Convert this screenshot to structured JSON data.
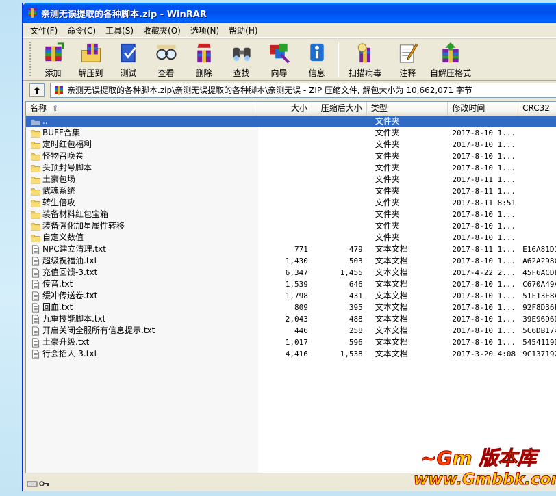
{
  "window": {
    "title": "亲测无误提取的各种脚本.zip - WinRAR"
  },
  "menu": [
    {
      "label": "文件(F)"
    },
    {
      "label": "命令(C)"
    },
    {
      "label": "工具(S)"
    },
    {
      "label": "收藏夹(O)"
    },
    {
      "label": "选项(N)"
    },
    {
      "label": "帮助(H)"
    }
  ],
  "toolbar": [
    {
      "label": "添加",
      "icon": "add-archive-icon"
    },
    {
      "label": "解压到",
      "icon": "extract-to-icon"
    },
    {
      "label": "测试",
      "icon": "test-icon"
    },
    {
      "label": "查看",
      "icon": "view-icon"
    },
    {
      "label": "删除",
      "icon": "delete-icon"
    },
    {
      "label": "查找",
      "icon": "find-icon"
    },
    {
      "label": "向导",
      "icon": "wizard-icon"
    },
    {
      "label": "信息",
      "icon": "info-icon"
    },
    {
      "label": "扫描病毒",
      "icon": "virus-scan-icon"
    },
    {
      "label": "注释",
      "icon": "comment-icon"
    },
    {
      "label": "自解压格式",
      "icon": "sfx-icon"
    }
  ],
  "address": {
    "path": "亲测无误提取的各种脚本.zip\\亲测无误提取的各种脚本\\亲测无误 - ZIP 压缩文件, 解包大小为 10,662,071 字节"
  },
  "columns": {
    "name": "名称",
    "size": "大小",
    "packed": "压缩后大小",
    "type": "类型",
    "modified": "修改时间",
    "crc": "CRC32"
  },
  "rows": [
    {
      "name": "..",
      "size": "",
      "packed": "",
      "type": "文件夹",
      "modified": "",
      "crc": "",
      "kind": "folder",
      "selected": true
    },
    {
      "name": "BUFF合集",
      "size": "",
      "packed": "",
      "type": "文件夹",
      "modified": "2017-8-10 1...",
      "crc": "",
      "kind": "folder"
    },
    {
      "name": "定时红包福利",
      "size": "",
      "packed": "",
      "type": "文件夹",
      "modified": "2017-8-10 1...",
      "crc": "",
      "kind": "folder"
    },
    {
      "name": "怪物召唤卷",
      "size": "",
      "packed": "",
      "type": "文件夹",
      "modified": "2017-8-10 1...",
      "crc": "",
      "kind": "folder"
    },
    {
      "name": "头顶封号脚本",
      "size": "",
      "packed": "",
      "type": "文件夹",
      "modified": "2017-8-10 1...",
      "crc": "",
      "kind": "folder"
    },
    {
      "name": "土豪包场",
      "size": "",
      "packed": "",
      "type": "文件夹",
      "modified": "2017-8-11 1...",
      "crc": "",
      "kind": "folder"
    },
    {
      "name": "武魂系统",
      "size": "",
      "packed": "",
      "type": "文件夹",
      "modified": "2017-8-11 1...",
      "crc": "",
      "kind": "folder"
    },
    {
      "name": "转生倍攻",
      "size": "",
      "packed": "",
      "type": "文件夹",
      "modified": "2017-8-11 8:51",
      "crc": "",
      "kind": "folder"
    },
    {
      "name": "装备材料红包宝箱",
      "size": "",
      "packed": "",
      "type": "文件夹",
      "modified": "2017-8-10 1...",
      "crc": "",
      "kind": "folder"
    },
    {
      "name": "装备强化加星属性转移",
      "size": "",
      "packed": "",
      "type": "文件夹",
      "modified": "2017-8-10 1...",
      "crc": "",
      "kind": "folder"
    },
    {
      "name": "自定义数值",
      "size": "",
      "packed": "",
      "type": "文件夹",
      "modified": "2017-8-10 1...",
      "crc": "",
      "kind": "folder"
    },
    {
      "name": "NPC建立清理.txt",
      "size": "771",
      "packed": "479",
      "type": "文本文档",
      "modified": "2017-8-11 1...",
      "crc": "E16A81D1",
      "kind": "file"
    },
    {
      "name": "超级祝福油.txt",
      "size": "1,430",
      "packed": "503",
      "type": "文本文档",
      "modified": "2017-8-10 1...",
      "crc": "A62A298C",
      "kind": "file"
    },
    {
      "name": "充值回馈-3.txt",
      "size": "6,347",
      "packed": "1,455",
      "type": "文本文档",
      "modified": "2017-4-22 2...",
      "crc": "45F6ACDE",
      "kind": "file"
    },
    {
      "name": "传音.txt",
      "size": "1,539",
      "packed": "646",
      "type": "文本文档",
      "modified": "2017-8-10 1...",
      "crc": "C670A49A",
      "kind": "file"
    },
    {
      "name": "缓冲传送卷.txt",
      "size": "1,798",
      "packed": "431",
      "type": "文本文档",
      "modified": "2017-8-10 1...",
      "crc": "51F13E8A",
      "kind": "file"
    },
    {
      "name": "回血.txt",
      "size": "809",
      "packed": "395",
      "type": "文本文档",
      "modified": "2017-8-10 1...",
      "crc": "92F8D36F",
      "kind": "file"
    },
    {
      "name": "九重技能脚本.txt",
      "size": "2,043",
      "packed": "488",
      "type": "文本文档",
      "modified": "2017-8-10 1...",
      "crc": "39E96D6D",
      "kind": "file"
    },
    {
      "name": "开启关闭全服所有信息提示.txt",
      "size": "446",
      "packed": "258",
      "type": "文本文档",
      "modified": "2017-8-10 1...",
      "crc": "5C6DB174",
      "kind": "file"
    },
    {
      "name": "土豪升级.txt",
      "size": "1,017",
      "packed": "596",
      "type": "文本文档",
      "modified": "2017-8-10 1...",
      "crc": "5454119D",
      "kind": "file"
    },
    {
      "name": "行会招人-3.txt",
      "size": "4,416",
      "packed": "1,538",
      "type": "文本文档",
      "modified": "2017-3-20 4:08",
      "crc": "9C137192",
      "kind": "file"
    }
  ],
  "watermark": {
    "brand": "版本库",
    "url": "www.Gmbbk.com"
  },
  "colors": {
    "titlebar": "#0054e3",
    "selection": "#316ac5",
    "window_face": "#ece9d8"
  }
}
